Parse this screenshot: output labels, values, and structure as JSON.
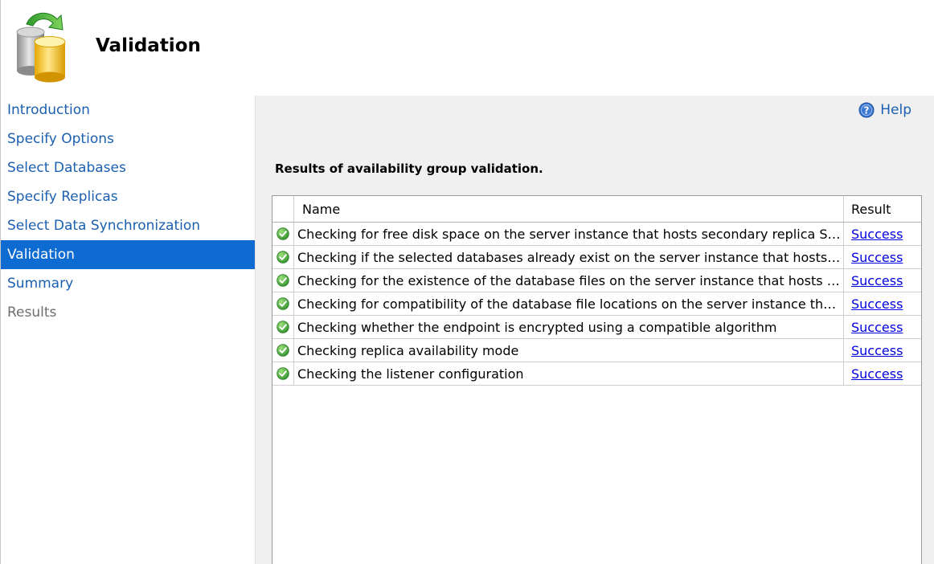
{
  "header": {
    "title": "Validation",
    "logo_icon": "database-refresh-icon"
  },
  "sidebar": {
    "items": [
      {
        "label": "Introduction",
        "state": "normal"
      },
      {
        "label": "Specify Options",
        "state": "normal"
      },
      {
        "label": "Select Databases",
        "state": "normal"
      },
      {
        "label": "Specify Replicas",
        "state": "normal"
      },
      {
        "label": "Select Data Synchronization",
        "state": "normal"
      },
      {
        "label": "Validation",
        "state": "active"
      },
      {
        "label": "Summary",
        "state": "normal"
      },
      {
        "label": "Results",
        "state": "disabled"
      }
    ]
  },
  "help": {
    "label": "Help",
    "icon": "help-icon"
  },
  "results": {
    "heading": "Results of availability group validation.",
    "columns": {
      "name": "Name",
      "result": "Result"
    },
    "rows": [
      {
        "name": "Checking for free disk space on the server instance that hosts secondary replica SQ...",
        "result": "Success",
        "status_icon": "success-check-icon"
      },
      {
        "name": "Checking if the selected databases already exist on the server instance that hosts se...",
        "result": "Success",
        "status_icon": "success-check-icon"
      },
      {
        "name": "Checking for the existence of the database files on the server instance that hosts se...",
        "result": "Success",
        "status_icon": "success-check-icon"
      },
      {
        "name": "Checking for compatibility of the database file locations on the server instance that ...",
        "result": "Success",
        "status_icon": "success-check-icon"
      },
      {
        "name": "Checking whether the endpoint is encrypted using a compatible algorithm",
        "result": "Success",
        "status_icon": "success-check-icon"
      },
      {
        "name": "Checking replica availability mode",
        "result": "Success",
        "status_icon": "success-check-icon"
      },
      {
        "name": "Checking the listener configuration",
        "result": "Success",
        "status_icon": "success-check-icon"
      }
    ]
  },
  "colors": {
    "accent": "#0d6bd1",
    "link": "#1b5fb0",
    "success": "#3aa635"
  }
}
